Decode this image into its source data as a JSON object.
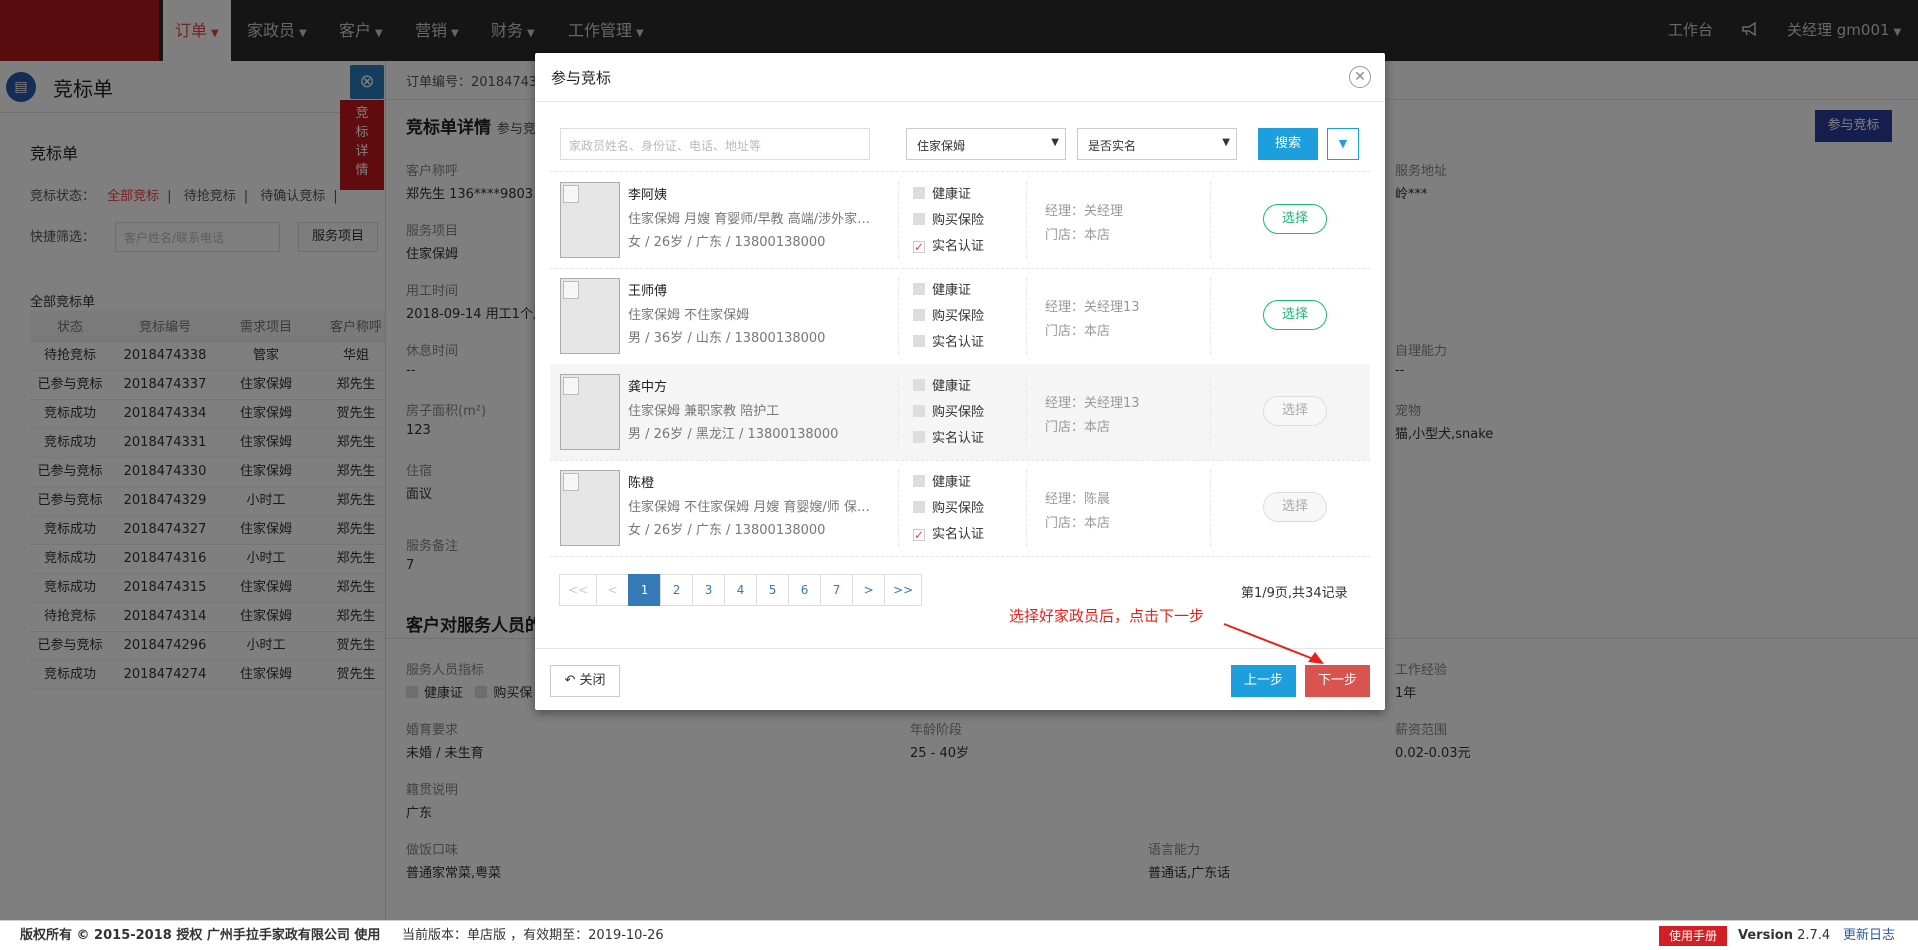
{
  "nav": {
    "items": [
      {
        "label": "订单"
      },
      {
        "label": "家政员"
      },
      {
        "label": "客户"
      },
      {
        "label": "营销"
      },
      {
        "label": "财务"
      },
      {
        "label": "工作管理"
      }
    ],
    "workbench": "工作台",
    "user": "关经理 gm001"
  },
  "left": {
    "title": "竞标单",
    "card_title": "竞标单",
    "status_label": "竞标状态：",
    "status_tabs": [
      "全部竞标",
      "待抢竞标",
      "待确认竞标"
    ],
    "quick_label": "快捷筛选：",
    "quick_placeholder": "客户姓名/联系电话",
    "quick_button": "服务项目",
    "all_label": "全部竞标单",
    "columns": [
      "状态",
      "竞标编号",
      "需求项目",
      "客户称呼"
    ],
    "rows": [
      {
        "status": "待抢竞标",
        "no": "2018474338",
        "item": "管家",
        "customer": "华姐"
      },
      {
        "status": "已参与竞标",
        "no": "2018474337",
        "item": "住家保姆",
        "customer": "郑先生"
      },
      {
        "status": "竞标成功",
        "no": "2018474334",
        "item": "住家保姆",
        "customer": "贺先生"
      },
      {
        "status": "竞标成功",
        "no": "2018474331",
        "item": "住家保姆",
        "customer": "郑先生"
      },
      {
        "status": "已参与竞标",
        "no": "2018474330",
        "item": "住家保姆",
        "customer": "郑先生"
      },
      {
        "status": "已参与竞标",
        "no": "2018474329",
        "item": "小时工",
        "customer": "郑先生"
      },
      {
        "status": "竞标成功",
        "no": "2018474327",
        "item": "住家保姆",
        "customer": "郑先生"
      },
      {
        "status": "竞标成功",
        "no": "2018474316",
        "item": "小时工",
        "customer": "郑先生"
      },
      {
        "status": "竞标成功",
        "no": "2018474315",
        "item": "住家保姆",
        "customer": "郑先生"
      },
      {
        "status": "待抢竞标",
        "no": "2018474314",
        "item": "住家保姆",
        "customer": "郑先生"
      },
      {
        "status": "已参与竞标",
        "no": "2018474296",
        "item": "小时工",
        "customer": "贺先生"
      },
      {
        "status": "竞标成功",
        "no": "2018474274",
        "item": "住家保姆",
        "customer": "贺先生"
      }
    ]
  },
  "side_tab": {
    "label": "竞标详情"
  },
  "detail": {
    "order_no": "订单编号：20184743",
    "section1_title": "竞标单详情",
    "section1_sub": "参与竞",
    "participate_button": "参与竞标",
    "customer_label": "客户称呼",
    "customer_value": "郑先生 136****9803",
    "service_item_label": "服务项目",
    "service_item_value": "住家保姆",
    "work_time_label": "用工时间",
    "work_time_value": "2018-09-14 用工1个月",
    "rest_label": "休息时间",
    "rest_value": "--",
    "area_label": "房子面积(m²)",
    "area_value": "123",
    "lodging_label": "住宿",
    "lodging_value": "面议",
    "remark_label": "服务备注",
    "remark_value": "7",
    "address_label": "服务地址",
    "address_value": "岭***",
    "selfcare_label": "自理能力",
    "selfcare_value": "--",
    "pet_label": "宠物",
    "pet_value": "猫,小型犬,snake",
    "section2_title": "客户对服务人员的",
    "staff_req_label": "服务人员指标",
    "staff_req_cb1": "健康证",
    "staff_req_cb2": "购买保",
    "experience_label": "工作经验",
    "experience_value": "1年",
    "marriage_label": "婚育要求",
    "marriage_value": "未婚 / 未生育",
    "age_label": "年龄阶段",
    "age_value": "25 - 40岁",
    "salary_label": "薪资范围",
    "salary_value": "0.02-0.03元",
    "origin_label": "籍贯说明",
    "origin_value": "广东",
    "cooking_label": "做饭口味",
    "cooking_value": "普通家常菜,粤菜",
    "language_label": "语言能力",
    "language_value": "普通话,广东话"
  },
  "modal": {
    "title": "参与竞标",
    "search_placeholder": "家政员姓名、身份证、电话、地址等",
    "select1": "住家保姆",
    "select2": "是否实名",
    "search_button": "搜索",
    "check_labels": [
      "健康证",
      "购买保险",
      "实名认证"
    ],
    "workers": [
      {
        "name": "李阿姨",
        "tags": "住家保姆 月嫂 育婴师/早教 高端/涉外家…",
        "info": "女 / 26岁 / 广东 / 13800138000",
        "checks": [
          false,
          false,
          true
        ],
        "manager": "经理：关经理",
        "store": "门店：本店",
        "select": "选择",
        "enabled": true
      },
      {
        "name": "王师傅",
        "tags": "住家保姆 不住家保姆",
        "info": "男 / 36岁 / 山东 / 13800138000",
        "checks": [
          false,
          false,
          false
        ],
        "manager": "经理：关经理13",
        "store": "门店：本店",
        "select": "选择",
        "enabled": true
      },
      {
        "name": "龚中方",
        "tags": "住家保姆 兼职家教 陪护工",
        "info": "男 / 26岁 / 黑龙江 / 13800138000",
        "checks": [
          false,
          false,
          false
        ],
        "manager": "经理：关经理13",
        "store": "门店：本店",
        "select": "选择",
        "enabled": false
      },
      {
        "name": "陈橙",
        "tags": "住家保姆 不住家保姆 月嫂 育婴嫂/师 保…",
        "info": "女 / 26岁 / 广东 / 13800138000",
        "checks": [
          false,
          false,
          true
        ],
        "manager": "经理：陈晨",
        "store": "门店：本店",
        "select": "选择",
        "enabled": false
      }
    ],
    "pager": [
      "<<",
      "<",
      "1",
      "2",
      "3",
      "4",
      "5",
      "6",
      "7",
      ">",
      ">>"
    ],
    "current_page": "1",
    "page_info": "第1/9页,共34记录",
    "close_button": "关闭",
    "prev_button": "上一步",
    "next_button": "下一步"
  },
  "annotation": "选择好家政员后，点击下一步",
  "footer": {
    "copyright": "版权所有 © 2015-2018 授权 广州手拉手家政有限公司 使用",
    "version_text": "当前版本：单店版 ，有效期至：2019-10-26",
    "manual": "使用手册",
    "version_label": "Version",
    "version_value": "2.7.4",
    "changelog": "更新日志"
  },
  "colors": {
    "brand_red": "#b0191d",
    "primary_blue": "#1e9fdd",
    "next_red": "#d9534f",
    "select_green": "#17b978"
  }
}
